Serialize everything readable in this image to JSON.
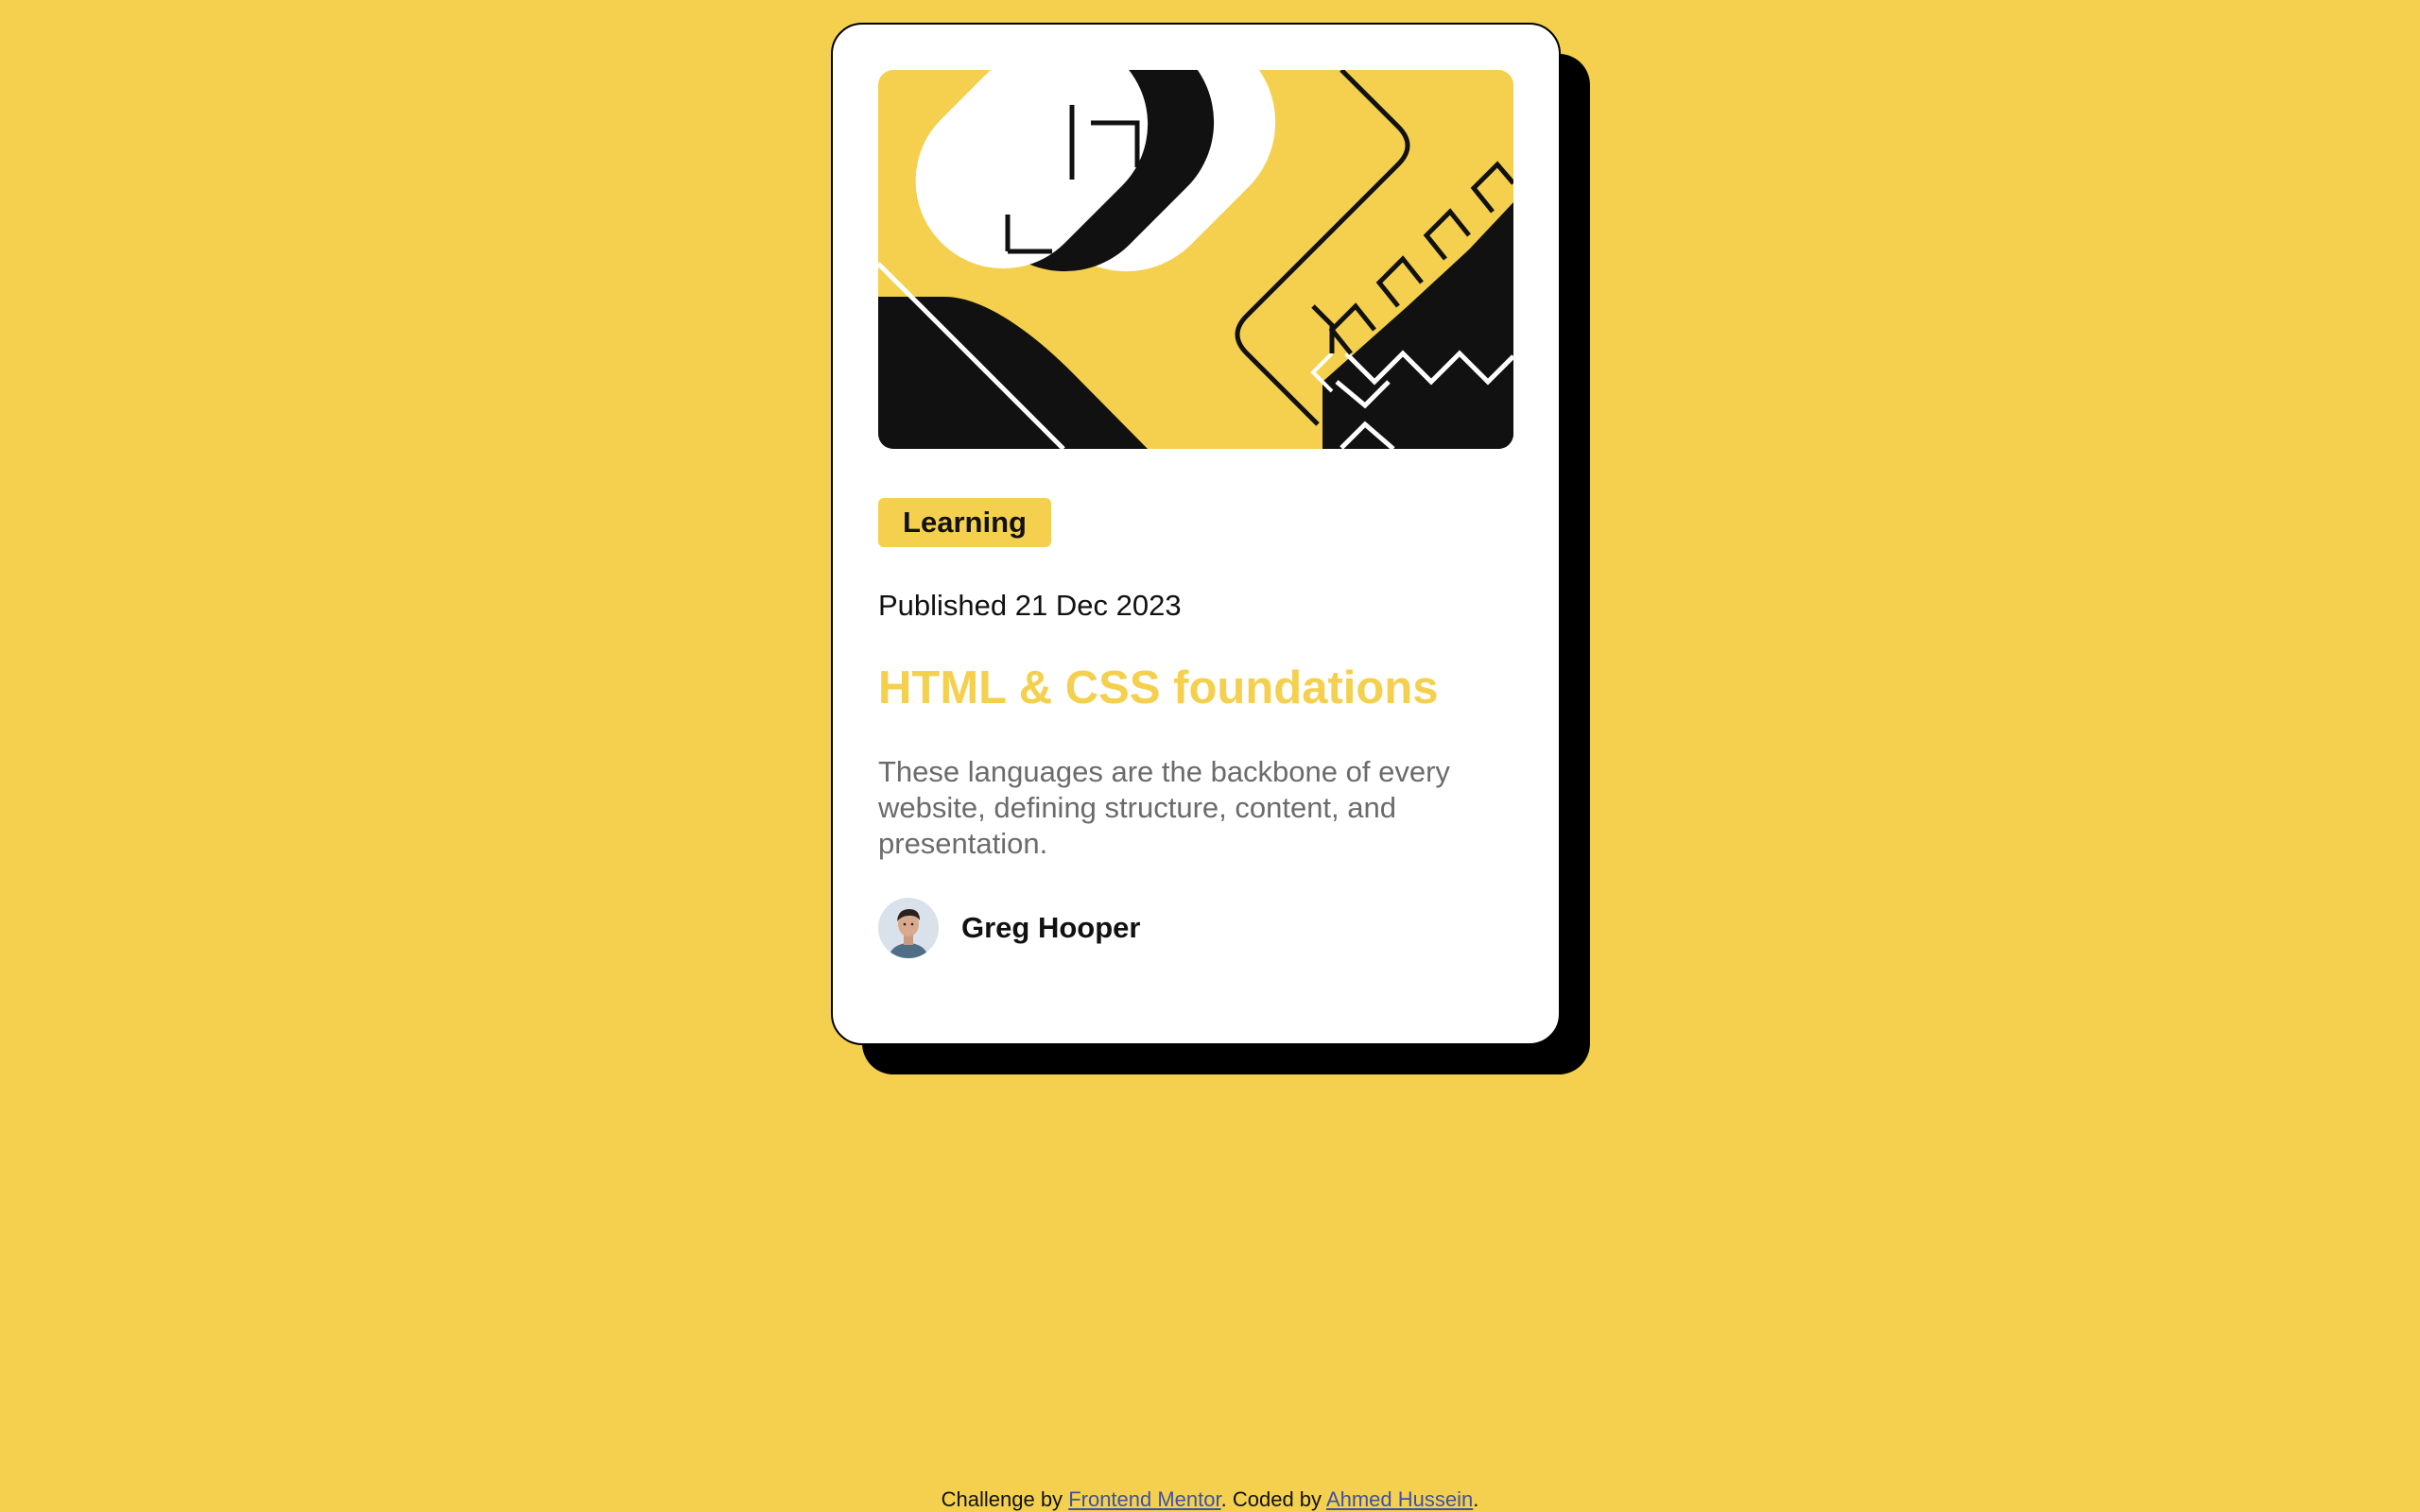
{
  "page": {
    "background_color": "#f4d04e"
  },
  "card": {
    "hero_image": "abstract illustration",
    "category_badge": "Learning",
    "published": "Published 21 Dec 2023",
    "title": "HTML & CSS foundations",
    "description": "These languages are the backbone of every website, defining structure, content, and presentation.",
    "author": {
      "name": "Greg Hooper",
      "avatar": "author-avatar"
    },
    "colors": {
      "accent": "#f4d04e",
      "text": "#111111",
      "muted": "#6b6b6b",
      "shadow": "#000000"
    }
  },
  "footer": {
    "prefix": "Challenge by",
    "challenge_link": "Frontend Mentor",
    "middle": ". Coded by",
    "author_link": "Ahmed Hussein",
    "suffix": "."
  }
}
